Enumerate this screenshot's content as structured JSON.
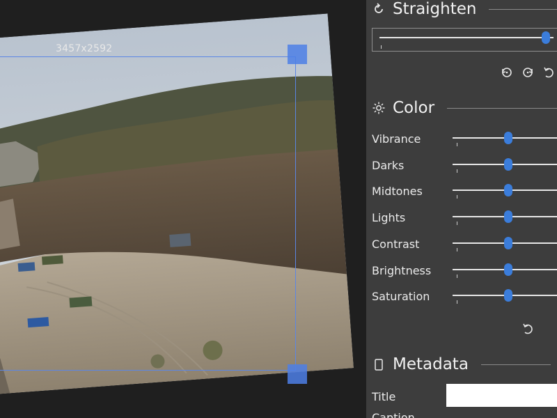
{
  "canvas": {
    "dimensions_label": "3457x2592"
  },
  "panel": {
    "straighten": {
      "title": "Straighten",
      "icon": "straighten-icon",
      "value": 0.98
    },
    "rotate_buttons": [
      {
        "icon": "rotate-left-icon"
      },
      {
        "icon": "rotate-right-icon"
      },
      {
        "icon": "reset-icon"
      }
    ],
    "color": {
      "title": "Color",
      "icon": "sun-icon",
      "sliders": [
        {
          "label": "Vibrance",
          "value": 0.5
        },
        {
          "label": "Darks",
          "value": 0.5
        },
        {
          "label": "Midtones",
          "value": 0.5
        },
        {
          "label": "Lights",
          "value": 0.5
        },
        {
          "label": "Contrast",
          "value": 0.5
        },
        {
          "label": "Brightness",
          "value": 0.5
        },
        {
          "label": "Saturation",
          "value": 0.5
        }
      ],
      "reset_icon": "reset-icon"
    },
    "metadata": {
      "title": "Metadata",
      "icon": "document-icon",
      "title_label": "Title",
      "title_value": "",
      "caption_label": "Caption"
    }
  },
  "colors": {
    "accent": "#3b7ddb",
    "crop": "#5b86e5",
    "panel_bg": "#3d3d3d"
  }
}
